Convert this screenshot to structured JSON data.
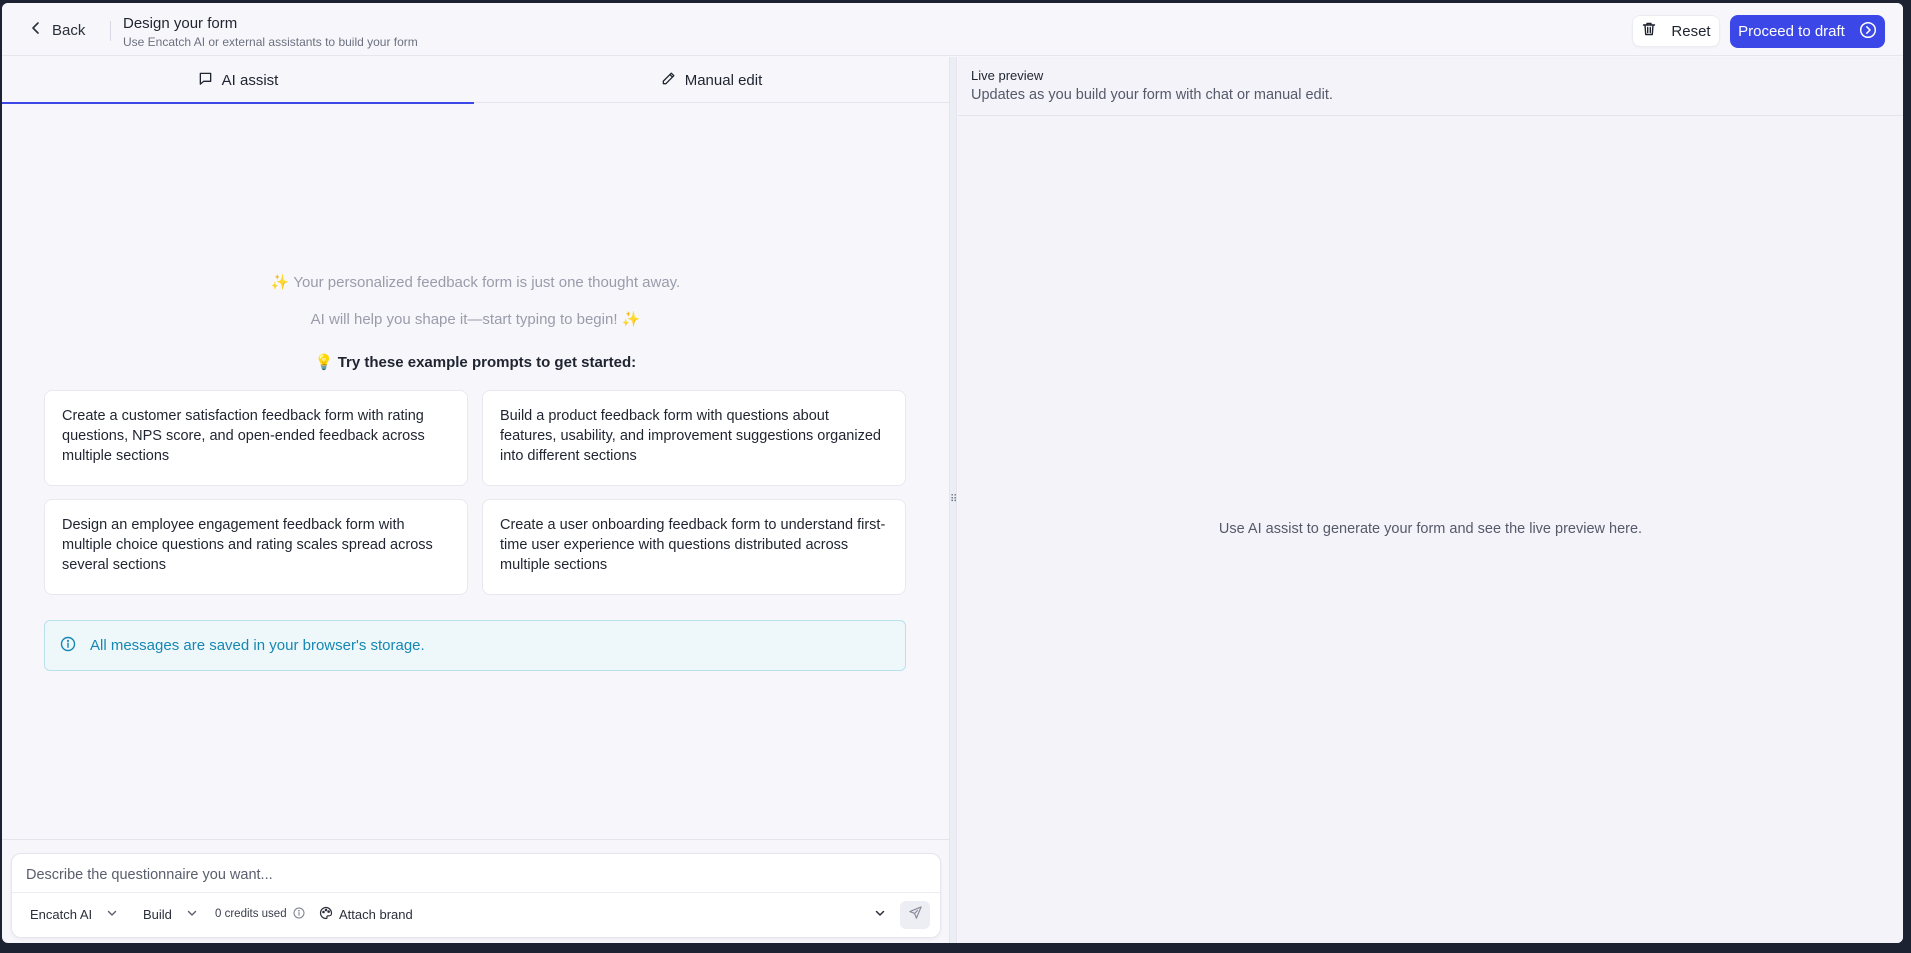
{
  "header": {
    "back_label": "Back",
    "title": "Design your form",
    "subtitle": "Use Encatch AI or external assistants to build your form",
    "reset_label": "Reset",
    "proceed_label": "Proceed to draft"
  },
  "tabs": [
    {
      "label": "AI assist",
      "icon": "chat-icon",
      "active": true
    },
    {
      "label": "Manual edit",
      "icon": "pencil-icon",
      "active": false
    }
  ],
  "chat": {
    "intro_line_1": "✨ Your personalized feedback form is just one thought away.",
    "intro_line_2": "AI will help you shape it—start typing to begin! ✨",
    "prompts_heading": "💡 Try these example prompts to get started:",
    "prompts": [
      "Create a customer satisfaction feedback form with rating questions, NPS score, and open-ended feedback across multiple sections",
      "Build a product feedback form with questions about features, usability, and improvement suggestions organized into different sections",
      "Design an employee engagement feedback form with multiple choice questions and rating scales spread across several sections",
      "Create a user onboarding feedback form to understand first-time user experience with questions distributed across multiple sections"
    ],
    "info_message": "All messages are saved in your browser's storage."
  },
  "composer": {
    "placeholder": "Describe the questionnaire you want...",
    "engine_label": "Encatch AI",
    "mode_label": "Build",
    "credits_label": "0 credits used",
    "attach_label": "Attach brand"
  },
  "preview": {
    "title": "Live preview",
    "subtitle": "Updates as you build your form with chat or manual edit.",
    "empty_message": "Use AI assist to generate your form and see the live preview here."
  },
  "colors": {
    "accent": "#3b47e6",
    "info_text": "#1687b3",
    "info_bg": "#eef8fb"
  }
}
